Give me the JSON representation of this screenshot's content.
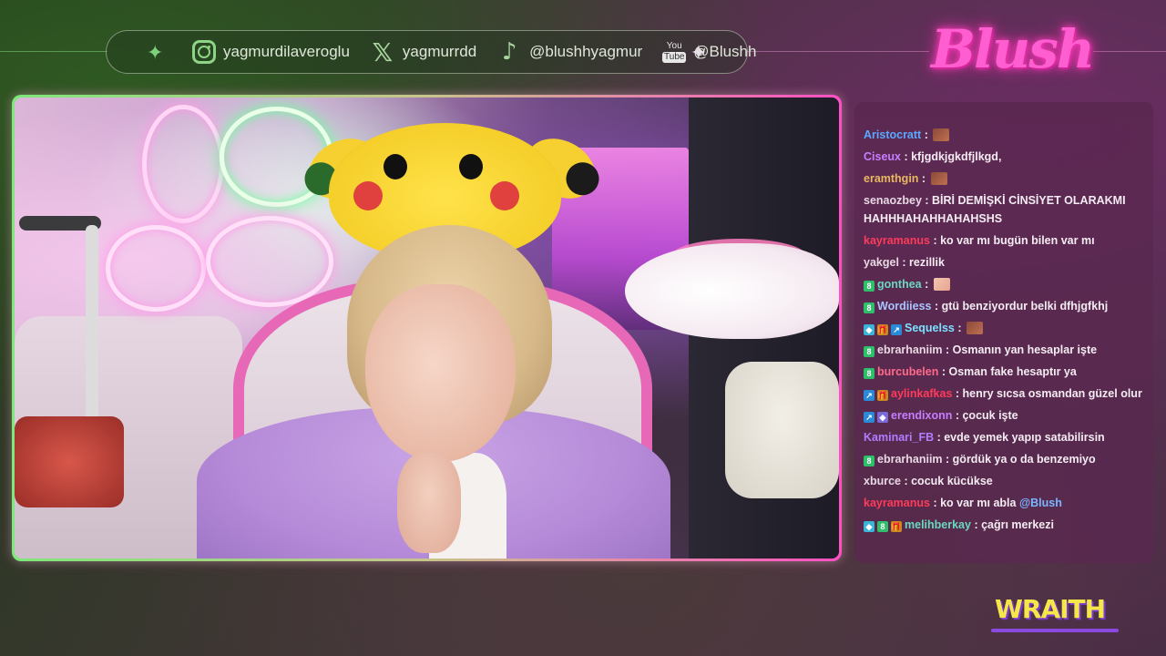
{
  "social": {
    "instagram": "yagmurdilaveroglu",
    "x": "yagmurrdd",
    "tiktok": "@blushhyagmur",
    "youtube": "@Blushh",
    "youtube_icon_top": "You",
    "youtube_icon_bottom": "Tube"
  },
  "brand": {
    "logo": "Blush",
    "sponsor": "WRAITH"
  },
  "chat": {
    "messages": [
      {
        "user": "Aristocratt",
        "color": "#5aa8ff",
        "text": "",
        "emote": "brown"
      },
      {
        "user": "Ciseux",
        "color": "#c77dff",
        "text": "kfjgdkjgkdfjlkgd,"
      },
      {
        "user": "eramthgin",
        "color": "#e8b860",
        "text": "",
        "emote": "brown"
      },
      {
        "user": "senaozbey",
        "color": "#e8d8e4",
        "text": "BİRİ DEMİŞKİ CİNSİYET OLARAKMI HAHHHAHAHHAHAHSHS"
      },
      {
        "user": "kayramanus",
        "color": "#ff3a5a",
        "text": "ko var mı bugün bilen var mı"
      },
      {
        "user": "yakgel",
        "color": "#e8d8e4",
        "text": "rezillik"
      },
      {
        "user": "gonthea",
        "color": "#6ad8c0",
        "text": "",
        "emote": "skin",
        "badges": [
          "sub"
        ]
      },
      {
        "user": "Wordiiess",
        "color": "#a9c4ff",
        "text": "gtü benziyordur belki dfhjgfkhj",
        "badges": [
          "sub"
        ]
      },
      {
        "user": "Sequelss",
        "color": "#7ae0ff",
        "text": "",
        "emote": "brown",
        "badges": [
          "gem",
          "gift",
          "prime"
        ]
      },
      {
        "user": "ebrarhaniim",
        "color": "#e8d8e4",
        "text": "Osmanın yan hesaplar işte",
        "badges": [
          "sub"
        ]
      },
      {
        "user": "burcubelen",
        "color": "#ff6a8a",
        "text": "Osman fake hesaptır ya",
        "badges": [
          "sub"
        ]
      },
      {
        "user": "aylinkafkas",
        "color": "#ff3a5a",
        "text": "henry sıcsa osmandan güzel olur",
        "badges": [
          "prime",
          "gift"
        ]
      },
      {
        "user": "erendixonn",
        "color": "#c77dff",
        "text": "çocuk işte",
        "badges": [
          "prime",
          "vip"
        ]
      },
      {
        "user": "Kaminari_FB",
        "color": "#b07dff",
        "text": "evde yemek yapıp satabilirsin"
      },
      {
        "user": "ebrarhaniim",
        "color": "#e8d8e4",
        "text": "gördük ya o da benzemiyo",
        "badges": [
          "sub"
        ]
      },
      {
        "user": "xburce",
        "color": "#e8d8e4",
        "text": "cocuk kücükse"
      },
      {
        "user": "kayramanus",
        "color": "#ff3a5a",
        "text": "ko var mı abla ",
        "mention": "@Blush"
      },
      {
        "user": "melihberkay",
        "color": "#6ad8c0",
        "text": "çağrı merkezi",
        "badges": [
          "gem",
          "sub",
          "gift"
        ]
      }
    ]
  }
}
